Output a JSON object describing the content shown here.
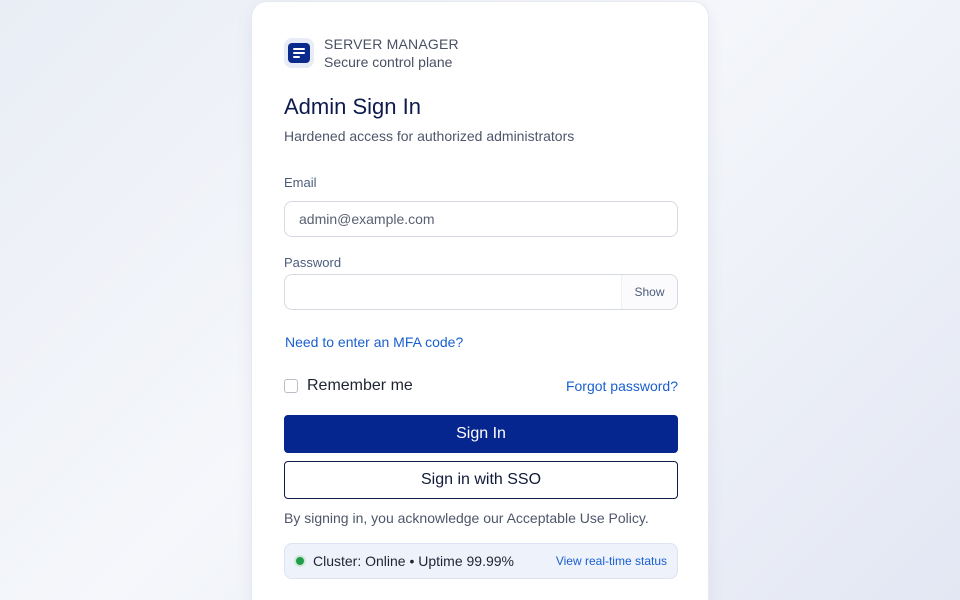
{
  "brand": {
    "name": "SERVER MANAGER",
    "tagline": "Secure control plane",
    "logo_icon": "document-lines-icon"
  },
  "header": {
    "title": "Admin Sign In",
    "subtitle": "Hardened access for authorized administrators"
  },
  "form": {
    "email_label": "Email",
    "email_placeholder": "admin@example.com",
    "email_value": "",
    "password_label": "Password",
    "password_value": "",
    "show_label": "Show",
    "mfa_link": "Need to enter an MFA code?",
    "remember_label": "Remember me",
    "remember_checked": false,
    "forgot_link": "Forgot password?",
    "signin_label": "Sign In",
    "sso_label": "Sign in with SSO"
  },
  "policy_text": "By signing in, you acknowledge our Acceptable Use Policy.",
  "status": {
    "text": "Cluster: Online • Uptime 99.99%",
    "link": "View real-time status",
    "indicator_color": "#1f9d4a"
  },
  "colors": {
    "primary": "#06268f",
    "link": "#1a5fd0",
    "title": "#0c1a4d"
  }
}
